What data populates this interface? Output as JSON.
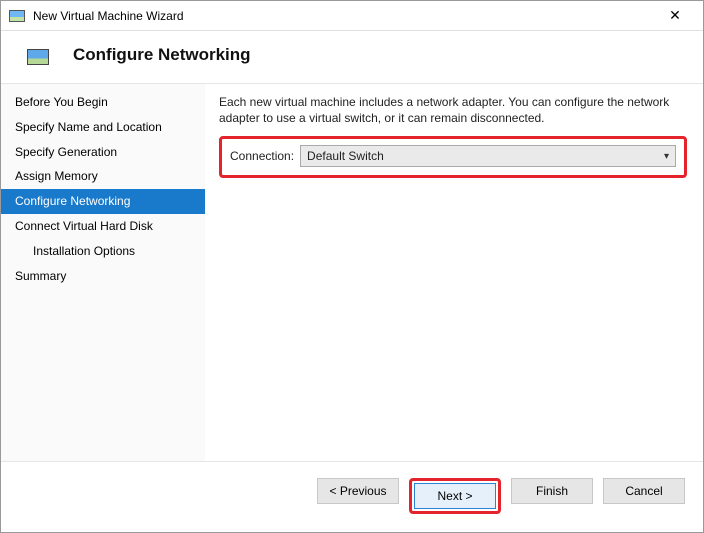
{
  "titlebar": {
    "title": "New Virtual Machine Wizard"
  },
  "header": {
    "title": "Configure Networking"
  },
  "sidebar": {
    "items": [
      {
        "label": "Before You Begin",
        "indent": false,
        "selected": false
      },
      {
        "label": "Specify Name and Location",
        "indent": false,
        "selected": false
      },
      {
        "label": "Specify Generation",
        "indent": false,
        "selected": false
      },
      {
        "label": "Assign Memory",
        "indent": false,
        "selected": false
      },
      {
        "label": "Configure Networking",
        "indent": false,
        "selected": true
      },
      {
        "label": "Connect Virtual Hard Disk",
        "indent": false,
        "selected": false
      },
      {
        "label": "Installation Options",
        "indent": true,
        "selected": false
      },
      {
        "label": "Summary",
        "indent": false,
        "selected": false
      }
    ]
  },
  "content": {
    "description": "Each new virtual machine includes a network adapter. You can configure the network adapter to use a virtual switch, or it can remain disconnected.",
    "connection_label": "Connection:",
    "connection_value": "Default Switch"
  },
  "footer": {
    "previous": "< Previous",
    "next": "Next >",
    "finish": "Finish",
    "cancel": "Cancel"
  }
}
